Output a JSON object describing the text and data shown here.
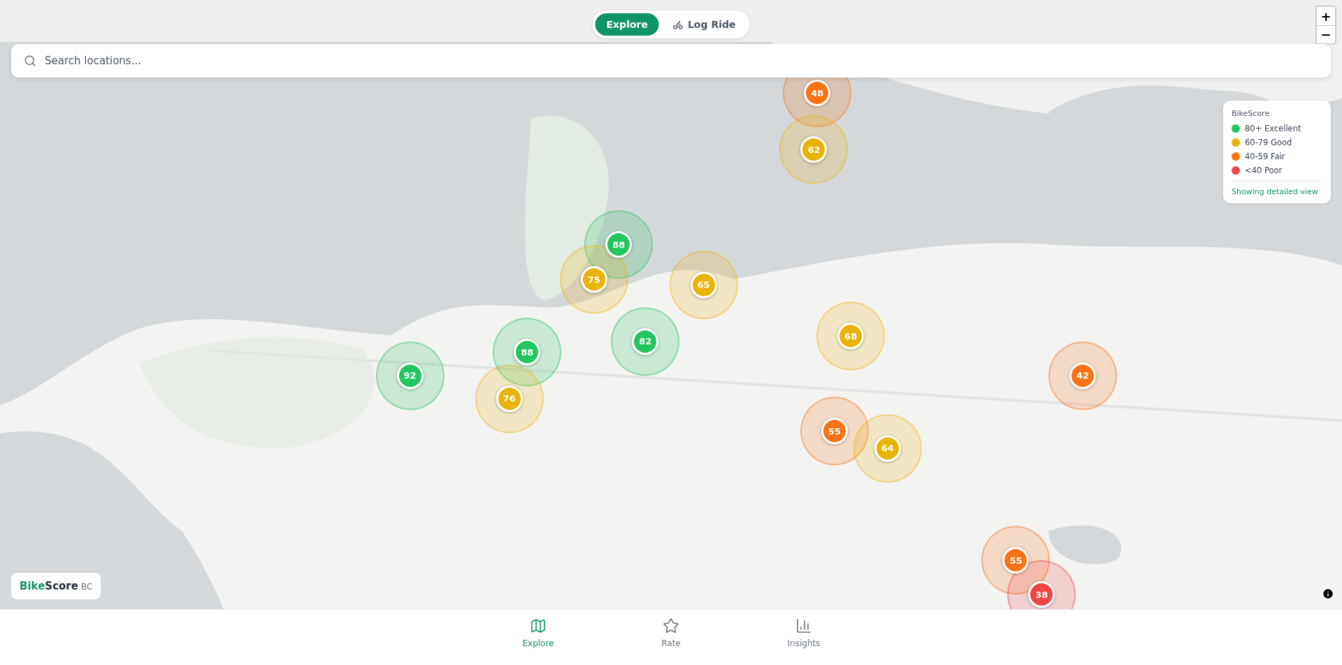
{
  "mode_toggle": [
    {
      "label": "Explore",
      "selected": true,
      "kind": "text"
    },
    {
      "label": "Log Ride",
      "selected": false,
      "kind": "bike"
    }
  ],
  "search": {
    "placeholder": "Search locations..."
  },
  "zoom_controls": [
    "+",
    "−"
  ],
  "markers": [
    {
      "score": "48",
      "color": "#f97316"
    },
    {
      "score": "62",
      "color": "#eab308"
    },
    {
      "score": "88",
      "color": "#22c55e"
    },
    {
      "score": "75",
      "color": "#eab308"
    },
    {
      "score": "65",
      "color": "#eab308"
    },
    {
      "score": "82",
      "color": "#22c55e"
    },
    {
      "score": "88",
      "color": "#22c55e"
    },
    {
      "score": "92",
      "color": "#22c55e"
    },
    {
      "score": "76",
      "color": "#eab308"
    },
    {
      "score": "68",
      "color": "#eab308"
    },
    {
      "score": "42",
      "color": "#f97316"
    },
    {
      "score": "55",
      "color": "#f97316"
    },
    {
      "score": "64",
      "color": "#eab308"
    },
    {
      "score": "55",
      "color": "#f97316"
    },
    {
      "score": "38",
      "color": "#ef4444"
    }
  ],
  "legend": {
    "title": "BikeScore",
    "items": [
      {
        "label": "80+ Excellent",
        "color": "#22c55e"
      },
      {
        "label": "60-79 Good",
        "color": "#eab308"
      },
      {
        "label": "40-59 Fair",
        "color": "#f97316"
      },
      {
        "label": "<40 Poor",
        "color": "#ef4444"
      }
    ],
    "note": "Showing detailed view"
  },
  "brand": {
    "name_accent": "Bike",
    "name_main": "Score",
    "suffix": "BC"
  },
  "bottom_nav": [
    {
      "label": "Explore",
      "selected": true,
      "kind": "map"
    },
    {
      "label": "Rate",
      "selected": false,
      "kind": "star"
    },
    {
      "label": "Insights",
      "selected": false,
      "kind": "chart"
    }
  ]
}
